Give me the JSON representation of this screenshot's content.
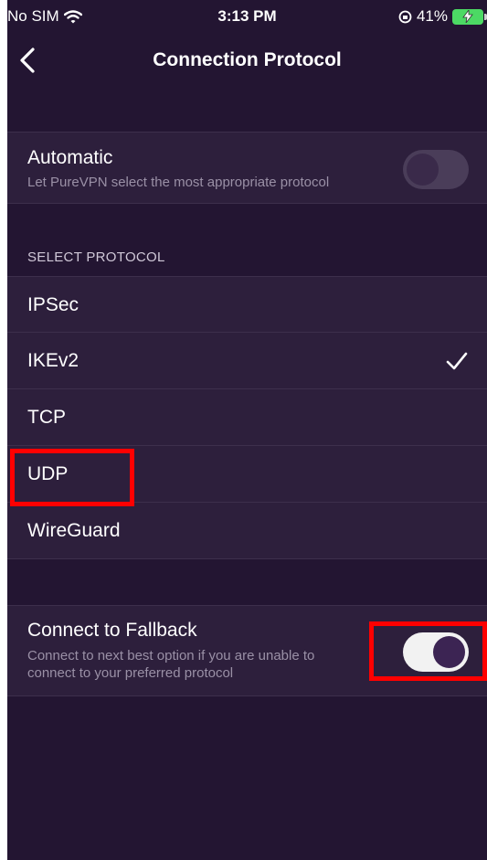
{
  "status_bar": {
    "carrier": "No SIM",
    "time": "3:13 PM",
    "battery": "41%"
  },
  "nav": {
    "title": "Connection Protocol"
  },
  "automatic": {
    "title": "Automatic",
    "subtitle": "Let PureVPN select the most appropriate protocol",
    "enabled": false
  },
  "protocol_section": {
    "header": "SELECT PROTOCOL",
    "items": [
      {
        "label": "IPSec",
        "selected": false
      },
      {
        "label": "IKEv2",
        "selected": true
      },
      {
        "label": "TCP",
        "selected": false
      },
      {
        "label": "UDP",
        "selected": false
      },
      {
        "label": "WireGuard",
        "selected": false
      }
    ]
  },
  "fallback": {
    "title": "Connect to Fallback",
    "subtitle_line1": "Connect to next best option if you are unable to",
    "subtitle_line2": "connect to your preferred protocol",
    "enabled": true
  },
  "colors": {
    "background": "#231532",
    "row": "#2d1f3c",
    "highlight": "#ff0000"
  }
}
